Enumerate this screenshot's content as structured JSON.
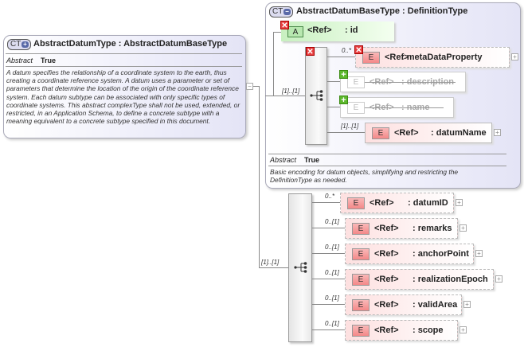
{
  "left_type": {
    "icon": "CT+",
    "title": "AbstractDatumType : AbstractDatumBaseType",
    "abstract_label": "Abstract",
    "abstract_value": "True",
    "description": "A datum specifies the relationship of a coordinate system to the earth, thus creating a coordinate reference system. A datum uses a parameter or set of parameters that determine the location of the origin of the coordinate reference system. Each datum subtype can be associated with only specific types of coordinate systems. This abstract complexType shall not be used, extended, or restricted, in an Application Schema, to define a concrete subtype with a meaning equivalent to a concrete subtype specified in this document.",
    "collapse": "−"
  },
  "base_type": {
    "icon": "CT−",
    "title": "AbstractDatumBaseType : DefinitionType",
    "attribute": {
      "tag": "A",
      "ref": "<Ref>",
      "name": ": id"
    },
    "sequence_occurrence": "[1]..[1]",
    "elements": [
      {
        "ref": "<Ref>",
        "name": ": metaDataProperty",
        "occ": "0..*",
        "state": "removed"
      },
      {
        "ref": "<Ref>",
        "name": ": description",
        "occ": "",
        "state": "inherited"
      },
      {
        "ref": "<Ref>",
        "name": ": name",
        "occ": "",
        "state": "inherited"
      },
      {
        "ref": "<Ref>",
        "name": ": datumName",
        "occ": "[1]..[1]",
        "state": "normal"
      }
    ],
    "abstract_label": "Abstract",
    "abstract_value": "True",
    "description": "Basic encoding for datum objects, simplifying and restricting the DefinitionType as needed."
  },
  "main_sequence": {
    "occurrence": "[1]..[1]",
    "elements": [
      {
        "ref": "<Ref>",
        "name": ": datumID",
        "occ": "0..*"
      },
      {
        "ref": "<Ref>",
        "name": ": remarks",
        "occ": "0..[1]"
      },
      {
        "ref": "<Ref>",
        "name": ": anchorPoint",
        "occ": "0..[1]"
      },
      {
        "ref": "<Ref>",
        "name": ": realizationEpoch",
        "occ": "0..[1]"
      },
      {
        "ref": "<Ref>",
        "name": ": validArea",
        "occ": "0..[1]"
      },
      {
        "ref": "<Ref>",
        "name": ": scope",
        "occ": "0..[1]"
      }
    ]
  },
  "colors": {
    "element": "#f48888",
    "attribute": "#d8f5d0",
    "complex_type": "#e4e4f6"
  }
}
